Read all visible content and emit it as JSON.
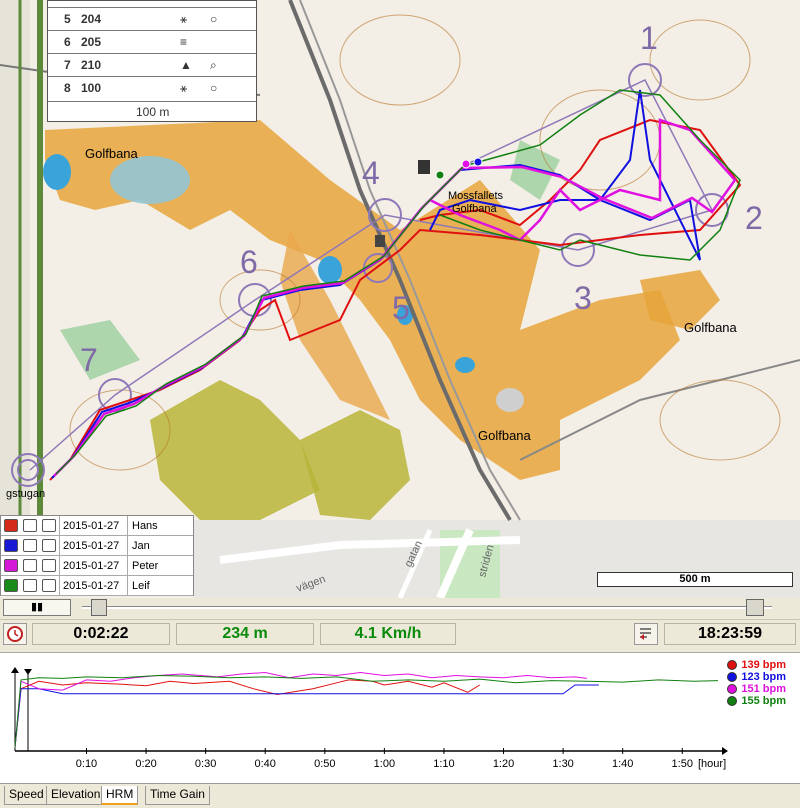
{
  "map": {
    "control_numbers": [
      "1",
      "2",
      "3",
      "4",
      "5",
      "6",
      "7"
    ],
    "labels": {
      "golfbana_nw": "Golfbana",
      "golfbana_se": "Golfbana",
      "golfbana_mid": "Golfbana",
      "mossfallets": "Mossfallets",
      "golfbana_small": "Golfbana",
      "gstugan": "gstugan",
      "road_vagen": "vägen",
      "road_gatan": "gatan",
      "road_leden": "striden"
    },
    "legend_table": {
      "rows": [
        {
          "num": "5",
          "code": "204",
          "sym": "⚹",
          "sym2": "○"
        },
        {
          "num": "6",
          "code": "205",
          "sym": "≡",
          "sym2": ""
        },
        {
          "num": "7",
          "code": "210",
          "sym": "▲",
          "sym2": "⌕"
        },
        {
          "num": "8",
          "code": "100",
          "sym": "⚹",
          "sym2": "○"
        }
      ],
      "scale": "100 m"
    },
    "scale_bar": "500 m"
  },
  "runners": [
    {
      "date": "2015-01-27",
      "name": "Hans",
      "color": "#d42a1a"
    },
    {
      "date": "2015-01-27",
      "name": "Jan",
      "color": "#1a1ad4"
    },
    {
      "date": "2015-01-27",
      "name": "Peter",
      "color": "#d41ad4"
    },
    {
      "date": "2015-01-27",
      "name": "Leif",
      "color": "#1a8a1a"
    }
  ],
  "playback": {
    "elapsed": "0:02:22",
    "distance": "234 m",
    "speed": "4.1 Km/h",
    "clock": "18:23:59",
    "pause_label": "▮▮"
  },
  "hr_legend": [
    {
      "label": "139 bpm",
      "color": "#e01010"
    },
    {
      "label": "123 bpm",
      "color": "#1010e0"
    },
    {
      "label": "151 bpm",
      "color": "#e010e0"
    },
    {
      "label": "155 bpm",
      "color": "#108010"
    }
  ],
  "chart_data": {
    "type": "line",
    "x_unit": "[hour]",
    "x_ticks": [
      "0:10",
      "0:20",
      "0:30",
      "0:40",
      "0:50",
      "1:00",
      "1:10",
      "1:20",
      "1:30",
      "1:40",
      "1:50"
    ],
    "x_range_minutes": [
      -2,
      58
    ],
    "series": [
      {
        "name": "139 bpm",
        "color": "#e01010",
        "x_minutes": [
          -2,
          -1,
          1,
          3,
          5,
          8,
          10,
          12,
          14,
          17,
          19,
          21,
          24,
          26,
          27,
          29,
          30,
          32,
          34,
          35,
          37,
          38
        ],
        "values": [
          60,
          140,
          150,
          145,
          148,
          146,
          144,
          150,
          147,
          150,
          140,
          132,
          140,
          148,
          152,
          150,
          145,
          150,
          142,
          148,
          135,
          145
        ]
      },
      {
        "name": "123 bpm",
        "color": "#1010e0",
        "x_minutes": [
          -2,
          -1,
          1,
          3,
          4,
          10,
          20,
          30,
          40,
          45,
          46,
          48
        ],
        "values": [
          60,
          140,
          140,
          133,
          133,
          133,
          133,
          133,
          133,
          133,
          145,
          145
        ]
      },
      {
        "name": "151 bpm",
        "color": "#e010e0",
        "x_minutes": [
          -2,
          -1,
          1,
          3,
          5,
          7,
          9,
          11,
          13,
          16,
          18,
          20,
          22,
          24,
          26,
          28,
          30,
          32,
          34,
          36,
          38,
          40,
          42,
          44,
          46,
          47
        ],
        "values": [
          60,
          150,
          140,
          138,
          152,
          150,
          155,
          158,
          160,
          156,
          160,
          162,
          155,
          160,
          158,
          162,
          158,
          160,
          155,
          158,
          156,
          155,
          158,
          155,
          156,
          154
        ]
      },
      {
        "name": "155 bpm",
        "color": "#108010",
        "x_minutes": [
          -2,
          -1,
          1,
          3,
          5,
          8,
          11,
          14,
          17,
          20,
          23,
          26,
          29,
          32,
          35,
          38,
          41,
          44,
          47,
          50,
          53,
          56,
          58
        ],
        "values": [
          60,
          152,
          155,
          154,
          156,
          155,
          158,
          157,
          155,
          156,
          154,
          156,
          150,
          152,
          150,
          153,
          148,
          151,
          150,
          149,
          152,
          150,
          151
        ]
      }
    ]
  },
  "tabs": [
    {
      "label": "Speed",
      "active": false
    },
    {
      "label": "Elevation",
      "active": false
    },
    {
      "label": "HRM",
      "active": true
    },
    {
      "label": "Time Gain",
      "active": false
    }
  ]
}
